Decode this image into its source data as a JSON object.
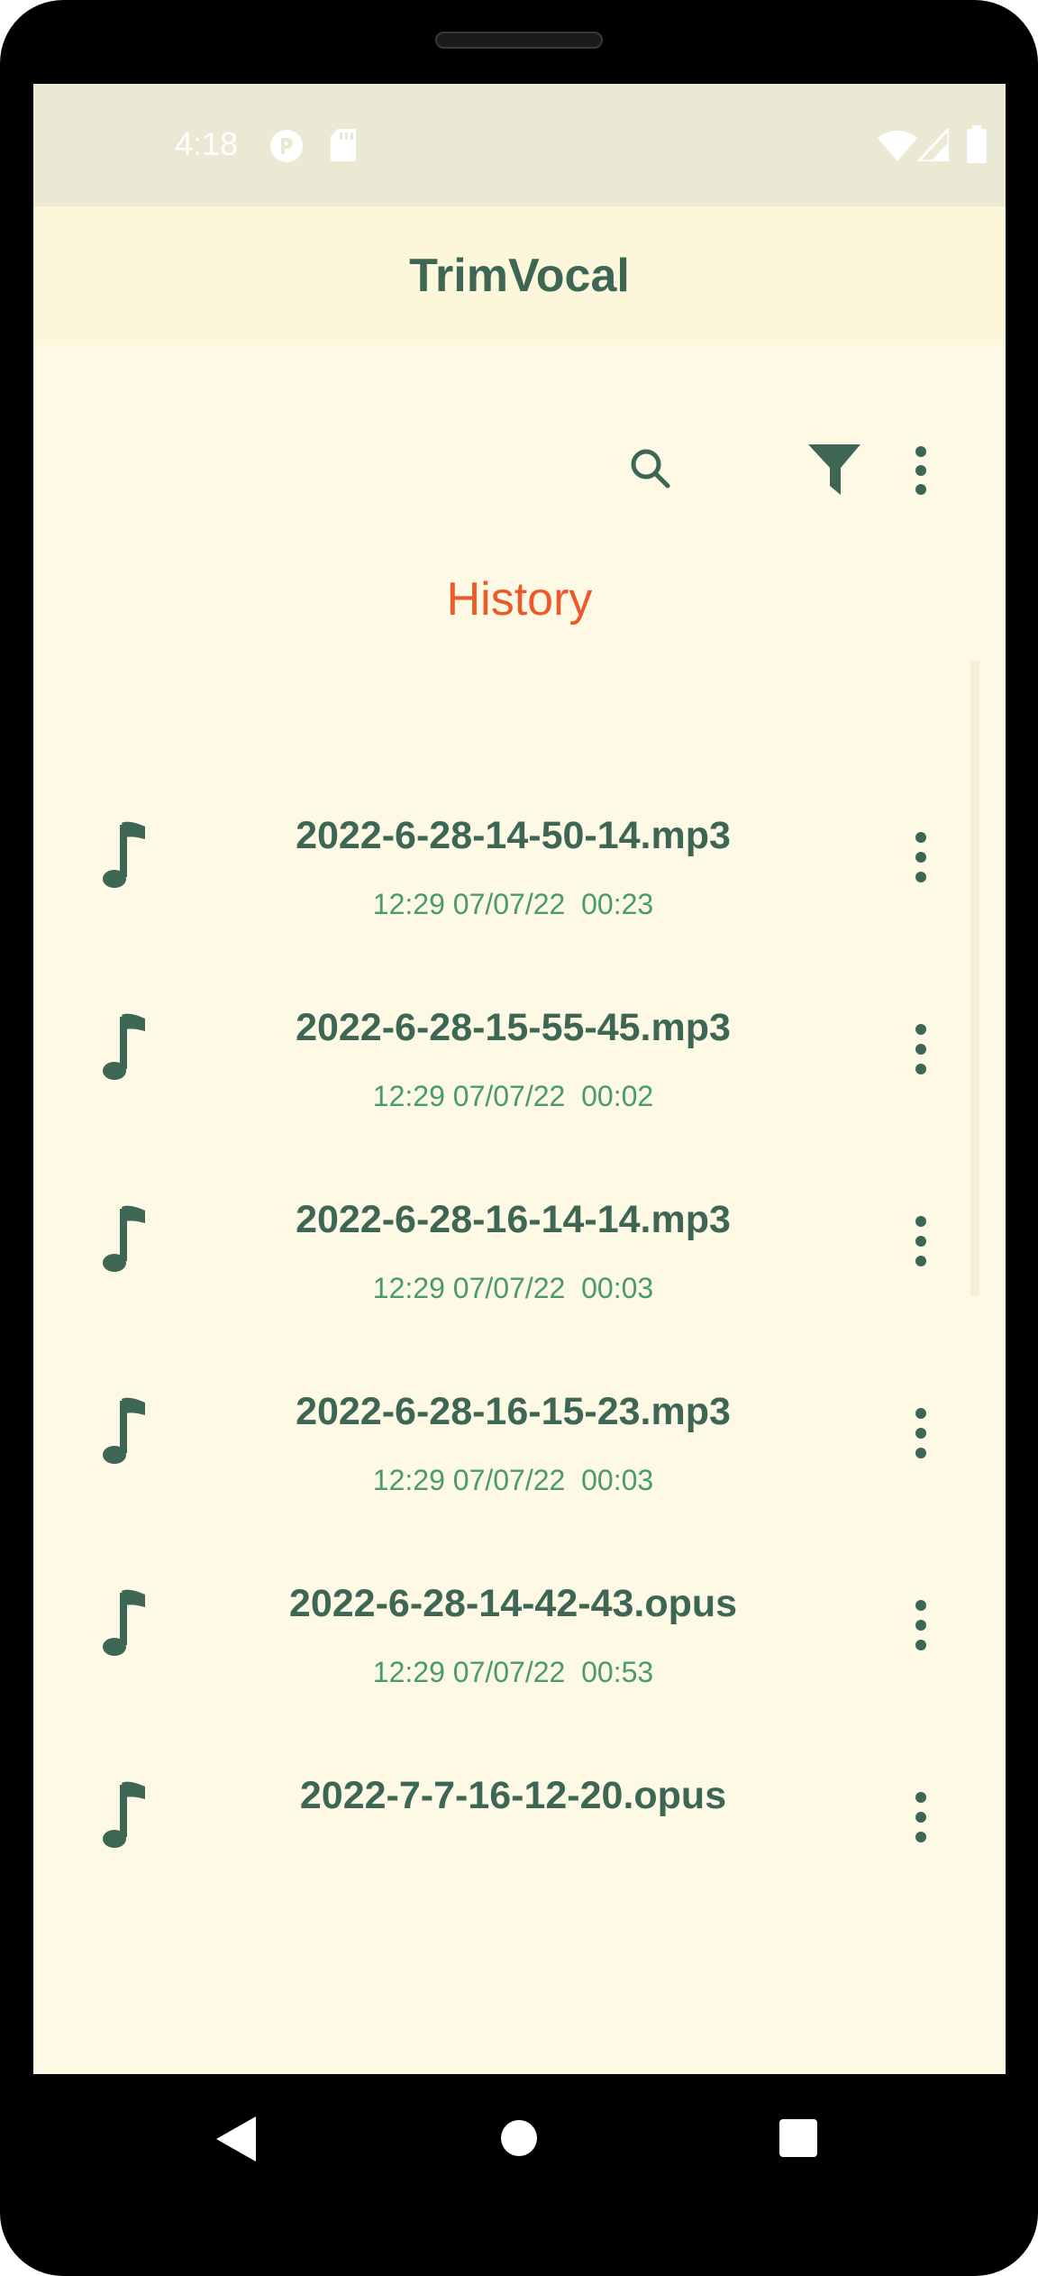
{
  "status_bar": {
    "time": "4:18",
    "icons": [
      "notification-app-icon",
      "sd-card-icon",
      "wifi-icon",
      "cellular-signal-icon",
      "battery-icon"
    ]
  },
  "app_bar": {
    "title": "TrimVocal"
  },
  "toolbar": {
    "icons": [
      "search-icon",
      "filter-icon",
      "more-vert-icon"
    ]
  },
  "section": {
    "title": "History"
  },
  "recordings": [
    {
      "file_name": "2022-6-28-14-50-14.mp3",
      "meta": "12:29 07/07/22  00:23"
    },
    {
      "file_name": "2022-6-28-15-55-45.mp3",
      "meta": "12:29 07/07/22  00:02"
    },
    {
      "file_name": "2022-6-28-16-14-14.mp3",
      "meta": "12:29 07/07/22  00:03"
    },
    {
      "file_name": "2022-6-28-16-15-23.mp3",
      "meta": "12:29 07/07/22  00:03"
    },
    {
      "file_name": "2022-6-28-14-42-43.opus",
      "meta": "12:29 07/07/22  00:53"
    },
    {
      "file_name": "2022-7-7-16-12-20.opus",
      "meta": ""
    }
  ],
  "navigation_bar": {
    "icons": [
      "back-icon",
      "home-icon",
      "recents-icon"
    ]
  },
  "colors": {
    "accent": "#3d6655",
    "section_title": "#ec5a2b",
    "meta_text": "#4a9b6b",
    "background": "#fdf9e5"
  }
}
